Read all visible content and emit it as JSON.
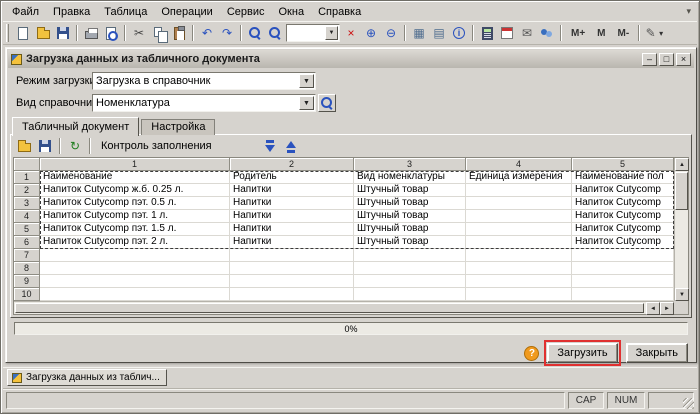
{
  "menu_bar": {
    "items": [
      {
        "label": "Файл"
      },
      {
        "label": "Правка"
      },
      {
        "label": "Таблица"
      },
      {
        "label": "Операции"
      },
      {
        "label": "Сервис"
      },
      {
        "label": "Окна"
      },
      {
        "label": "Справка"
      }
    ]
  },
  "toolbar": {
    "buttons": [
      {
        "kind": "icon",
        "name": "new-document-button",
        "style": "page"
      },
      {
        "kind": "icon",
        "name": "open-button",
        "style": "folder"
      },
      {
        "kind": "icon",
        "name": "save-button",
        "style": "floppy"
      },
      {
        "kind": "sep"
      },
      {
        "kind": "icon",
        "name": "print-button",
        "style": "printer"
      },
      {
        "kind": "icon",
        "name": "print-preview-button",
        "style": "preview"
      },
      {
        "kind": "sep"
      },
      {
        "kind": "icon",
        "name": "cut-button",
        "glyph": "✂",
        "color": "#444444"
      },
      {
        "kind": "icon",
        "name": "copy-button",
        "style": "copy"
      },
      {
        "kind": "icon",
        "name": "paste-button",
        "style": "paste"
      },
      {
        "kind": "sep"
      },
      {
        "kind": "icon",
        "name": "undo-button",
        "glyph": "↶",
        "color": "#2a52be"
      },
      {
        "kind": "icon",
        "name": "redo-button",
        "glyph": "↷",
        "color": "#2a52be"
      },
      {
        "kind": "sep"
      },
      {
        "kind": "icon",
        "name": "find-button",
        "style": "magnifier"
      },
      {
        "kind": "icon",
        "name": "find-next-button",
        "style": "magnifier"
      },
      {
        "kind": "combo",
        "name": "search-combo",
        "value": ""
      },
      {
        "kind": "icon",
        "name": "clear-search-button",
        "glyph": "×",
        "color": "#cc1111"
      },
      {
        "kind": "icon",
        "name": "zoom-in-button",
        "glyph": "⊕",
        "color": "#2a52be"
      },
      {
        "kind": "icon",
        "name": "zoom-out-button",
        "glyph": "⊖",
        "color": "#2a52be"
      },
      {
        "kind": "sep"
      },
      {
        "kind": "icon",
        "name": "grid-view-button",
        "glyph": "▦",
        "color": "#4f6d8f"
      },
      {
        "kind": "icon",
        "name": "list-view-button",
        "glyph": "▤",
        "color": "#4f6d8f"
      },
      {
        "kind": "icon",
        "name": "info-button",
        "style": "info"
      },
      {
        "kind": "sep"
      },
      {
        "kind": "icon",
        "name": "calculator-button",
        "style": "calc"
      },
      {
        "kind": "icon",
        "name": "calendar-button",
        "style": "calendar"
      },
      {
        "kind": "icon",
        "name": "mail-button",
        "glyph": "✉",
        "color": "#555555"
      },
      {
        "kind": "icon",
        "name": "users-button",
        "style": "users"
      },
      {
        "kind": "sep"
      },
      {
        "kind": "text",
        "name": "memory-plus-button",
        "label": "M+"
      },
      {
        "kind": "text",
        "name": "memory-recall-button",
        "label": "M"
      },
      {
        "kind": "text",
        "name": "memory-minus-button",
        "label": "M-"
      },
      {
        "kind": "sep"
      },
      {
        "kind": "icon",
        "name": "tools-dropdown-button",
        "glyph": "✎",
        "color": "#555555",
        "dropdown": true
      }
    ]
  },
  "dialog": {
    "title": "Загрузка данных из табличного документа",
    "window_buttons": {
      "minimize": "–",
      "maximize": "□",
      "close": "×"
    },
    "form": {
      "load_mode_label": "Режим загрузки:",
      "load_mode_value": "Загрузка в справочник",
      "catalog_kind_label": "Вид справочника:",
      "catalog_kind_value": "Номенклатура"
    },
    "tabs": [
      {
        "label": "Табличный документ",
        "active": true
      },
      {
        "label": "Настройка",
        "active": false
      }
    ],
    "progress": {
      "value_label": "0%"
    },
    "footer": {
      "help_glyph": "?",
      "load_button": "Загрузить",
      "close_button": "Закрыть"
    }
  },
  "sheet_toolbar": {
    "buttons": [
      {
        "kind": "icon",
        "name": "open-file-button",
        "style": "folder"
      },
      {
        "kind": "icon",
        "name": "save-file-button",
        "style": "floppy"
      },
      {
        "kind": "sep"
      },
      {
        "kind": "icon",
        "name": "refresh-button",
        "glyph": "↻",
        "color": "#1e7d1e"
      },
      {
        "kind": "sep"
      },
      {
        "kind": "flat",
        "name": "fill-control-button",
        "label": "Контроль заполнения"
      },
      {
        "kind": "space"
      },
      {
        "kind": "icon",
        "name": "fill-column-button",
        "style": "arrdown"
      },
      {
        "kind": "icon",
        "name": "clear-column-button",
        "style": "arrup"
      }
    ]
  },
  "table": {
    "column_headers": [
      "1",
      "2",
      "3",
      "4",
      "5"
    ],
    "rows": [
      {
        "n": "1",
        "cells": [
          "Наименование",
          "Родитель",
          "Вид номенклатуры",
          "Единица измерения",
          "Наименование пол"
        ]
      },
      {
        "n": "2",
        "cells": [
          "Напиток Cutycomp ж.б. 0.25 л.",
          "Напитки",
          "Штучный товар",
          "",
          "Напиток Cutycomp"
        ]
      },
      {
        "n": "3",
        "cells": [
          "Напиток Cutycomp пэт. 0.5 л.",
          "Напитки",
          "Штучный товар",
          "",
          "Напиток Cutycomp"
        ]
      },
      {
        "n": "4",
        "cells": [
          "Напиток Cutycomp пэт. 1 л.",
          "Напитки",
          "Штучный товар",
          "",
          "Напиток Cutycomp"
        ]
      },
      {
        "n": "5",
        "cells": [
          "Напиток Cutycomp пэт. 1.5 л.",
          "Напитки",
          "Штучный товар",
          "",
          "Напиток Cutycomp"
        ]
      },
      {
        "n": "6",
        "cells": [
          "Напиток Cutycomp пэт. 2 л.",
          "Напитки",
          "Штучный товар",
          "",
          "Напиток Cutycomp"
        ]
      },
      {
        "n": "7",
        "cells": [
          "",
          "",
          "",
          "",
          ""
        ]
      },
      {
        "n": "8",
        "cells": [
          "",
          "",
          "",
          "",
          ""
        ]
      },
      {
        "n": "9",
        "cells": [
          "",
          "",
          "",
          "",
          ""
        ]
      },
      {
        "n": "10",
        "cells": [
          "",
          "",
          "",
          "",
          ""
        ]
      }
    ]
  },
  "taskbar": {
    "task_label": "Загрузка данных из таблич..."
  },
  "status_bar": {
    "cap": "CAP",
    "num": "NUM"
  }
}
